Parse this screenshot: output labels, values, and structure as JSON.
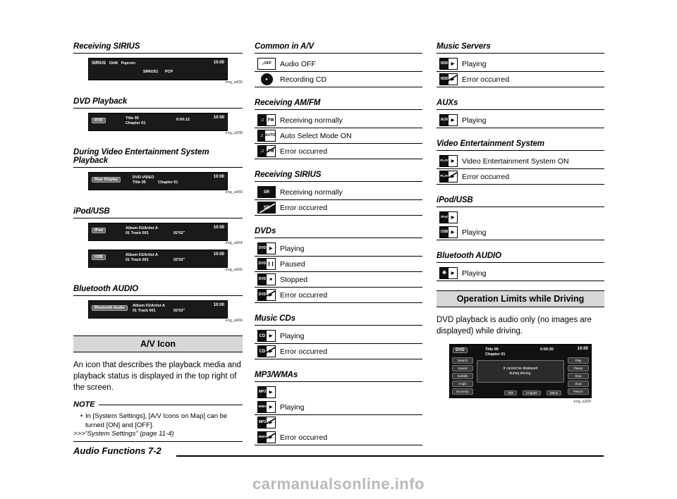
{
  "page": {
    "footer_title": "Audio Functions",
    "footer_page": "7-2",
    "watermark": "carmanualsonline.info"
  },
  "col1": {
    "sections": [
      {
        "title": "Receiving SIRIUS",
        "shots": [
          {
            "type": "sirius",
            "brand": "SIRIUS",
            "channel": "Ch08",
            "genre": "Popcorn",
            "line2_left": "SIRIUS1",
            "line2_right": "PCP",
            "clock": "10:00",
            "caption": "eng_a430"
          }
        ]
      },
      {
        "title": "DVD Playback",
        "shots": [
          {
            "type": "dvd",
            "label": "DVD",
            "title_text": "Title 05",
            "chapter_text": "Chapter 01",
            "time": "0:00:12",
            "clock": "10:00",
            "caption": "eng_a308"
          }
        ]
      },
      {
        "title": "During Video Entertainment System Playback",
        "shots": [
          {
            "type": "ves",
            "label": "Rear Display",
            "media": "DVD-VIDEO",
            "title_text": "Title 05",
            "chapter_text": "Chapter 01",
            "clock": "10:00",
            "caption": "eng_a455"
          }
        ]
      },
      {
        "title": "iPod/USB",
        "shots": [
          {
            "type": "ipod",
            "label": "iPod",
            "album": "Album 01/Artist A",
            "track": "01 Track 001",
            "time": "02'02\"",
            "clock": "10:00",
            "caption": "eng_a664"
          },
          {
            "type": "usb",
            "label": "USB",
            "album": "Album 01/Artist A",
            "track": "01 Track 001",
            "time": "02'02\"",
            "clock": "10:00",
            "caption": "eng_a665"
          }
        ]
      },
      {
        "title": "Bluetooth AUDIO",
        "shots": [
          {
            "type": "bt",
            "label": "Bluetooth Audio",
            "album": "Album 01/Artist A",
            "track": "01 Track 001",
            "time": "02'02\"",
            "clock": "10:00",
            "caption": "eng_a666"
          }
        ]
      }
    ],
    "av_icon": {
      "heading": "A/V Icon",
      "body": "An icon that describes the playback media and playback status is displayed in the top right of the screen.",
      "note_label": "NOTE",
      "note_items": [
        "In [System Settings], [A/V Icons on Map] can be turned [ON] and [OFF]."
      ],
      "reference": ">>>“System Settings” (page 11-4)"
    }
  },
  "col2": {
    "groups": [
      {
        "title": "Common in A/V",
        "rows": [
          {
            "icon": "audio-off-icon",
            "icon_text": "OFF",
            "label": "Audio OFF"
          },
          {
            "icon": "recording-cd-icon",
            "icon_text": "",
            "label": "Recording CD"
          }
        ]
      },
      {
        "title": "Receiving AM/FM",
        "rows": [
          {
            "icon": "radio-normal-icon",
            "icon_text": "FM",
            "label": "Receiving normally"
          },
          {
            "icon": "radio-auto-icon",
            "icon_text": "AUTO",
            "label": "Auto Select Mode ON"
          },
          {
            "icon": "radio-error-icon",
            "icon_text": "FM",
            "label": "Error occurred"
          }
        ]
      },
      {
        "title": "Receiving SIRIUS",
        "rows": [
          {
            "icon": "sirius-normal-icon",
            "icon_text": "SR",
            "label": "Receiving normally"
          },
          {
            "icon": "sirius-error-icon",
            "icon_text": "SR",
            "label": "Error occurred"
          }
        ]
      },
      {
        "title": "DVDs",
        "rows": [
          {
            "icon": "dvd-play-icon",
            "icon_text": "DVD",
            "label": "Playing"
          },
          {
            "icon": "dvd-pause-icon",
            "icon_text": "DVD",
            "label": "Paused"
          },
          {
            "icon": "dvd-stop-icon",
            "icon_text": "DVD",
            "label": "Stopped"
          },
          {
            "icon": "dvd-error-icon",
            "icon_text": "DVD",
            "label": "Error occurred"
          }
        ]
      },
      {
        "title": "Music CDs",
        "rows": [
          {
            "icon": "cd-play-icon",
            "icon_text": "CD",
            "label": "Playing"
          },
          {
            "icon": "cd-error-icon",
            "icon_text": "CD",
            "label": "Error occurred"
          }
        ]
      },
      {
        "title": "MP3/WMAs",
        "rows": [
          {
            "icon": "mp3-play-icon",
            "icon_text": "MP3",
            "label": ""
          },
          {
            "icon": "wma-play-icon",
            "icon_text": "WMA",
            "label": "Playing"
          },
          {
            "icon": "mp3-error-icon",
            "icon_text": "MP3",
            "label": ""
          },
          {
            "icon": "wma-error-icon",
            "icon_text": "WMA",
            "label": "Error occurred"
          }
        ]
      }
    ]
  },
  "col3": {
    "groups": [
      {
        "title": "Music Servers",
        "rows": [
          {
            "icon": "server-play-icon",
            "icon_text": "HDD",
            "label": "Playing"
          },
          {
            "icon": "server-error-icon",
            "icon_text": "HDD",
            "label": "Error occurred"
          }
        ]
      },
      {
        "title": "AUXs",
        "rows": [
          {
            "icon": "aux-play-icon",
            "icon_text": "AUX",
            "label": "Playing"
          }
        ]
      },
      {
        "title": "Video Entertainment System",
        "rows": [
          {
            "icon": "ves-on-icon",
            "icon_text": "PLAY",
            "label": "Video Entertainment System ON"
          },
          {
            "icon": "ves-error-icon",
            "icon_text": "PLAY",
            "label": "Error occurred"
          }
        ]
      },
      {
        "title": "iPod/USB",
        "rows": [
          {
            "icon": "ipod-play-icon",
            "icon_text": "iPod",
            "label": ""
          },
          {
            "icon": "usb-play-icon",
            "icon_text": "USB",
            "label": "Playing"
          }
        ]
      },
      {
        "title": "Bluetooth AUDIO",
        "rows": [
          {
            "icon": "bt-audio-play-icon",
            "icon_text": "BT",
            "label": "Playing"
          }
        ]
      }
    ],
    "operation_limits": {
      "heading": "Operation Limits while Driving",
      "body": "DVD playback is audio only (no images are displayed) while driving.",
      "shot": {
        "label": "DVD",
        "title_text": "Title 05",
        "chapter_text": "Chapter 01",
        "time": "0:00:20",
        "clock": "10:00",
        "left_buttons": [
          "Search",
          "Sound",
          "Subtitle",
          "Angle",
          "No  Entry"
        ],
        "right_buttons": [
          "Play",
          "Pause",
          "Stop",
          "Slow",
          "Return"
        ],
        "message_line1": "It cannot be displayed",
        "message_line2": "during driving.",
        "bottom_buttons": [
          "Title",
          "Chapter",
          "Menu"
        ],
        "caption": "eng_a309"
      }
    }
  }
}
